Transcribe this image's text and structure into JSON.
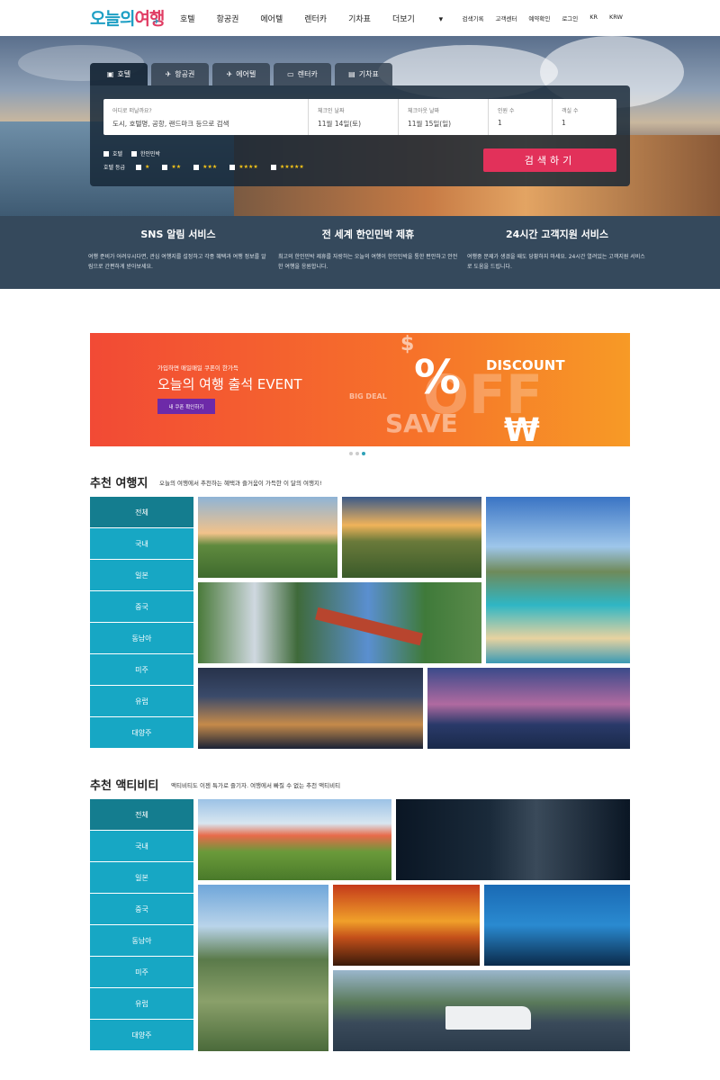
{
  "header": {
    "logo": {
      "part1": "오늘의",
      "part2": "여행"
    },
    "nav": [
      "호텔",
      "항공권",
      "에어텔",
      "렌터카",
      "기차표",
      "더보기"
    ],
    "util": [
      "검색기록",
      "고객센터",
      "예약확인",
      "로그인",
      "KR",
      "KRW"
    ]
  },
  "search": {
    "tabs": [
      "호텔",
      "항공권",
      "에어텔",
      "렌터카",
      "기차표"
    ],
    "fields": [
      {
        "label": "어디로 떠날까요?",
        "value": "도시, 호텔명, 공항, 랜드마크 등으로 검색"
      },
      {
        "label": "체크인 날짜",
        "value": "11월 14일(토)"
      },
      {
        "label": "체크아웃 날짜",
        "value": "11월 15일(일)"
      },
      {
        "label": "인원 수",
        "value": "1"
      },
      {
        "label": "객실 수",
        "value": "1"
      }
    ],
    "checks": [
      "호텔",
      "한인민박"
    ],
    "grade_label": "호텔 등급",
    "stars": [
      "★",
      "★★",
      "★★★",
      "★★★★",
      "★★★★★"
    ],
    "button": "검색하기"
  },
  "services": [
    {
      "title": "SNS 알림 서비스",
      "desc": "여행 준비가 어려우시다면, 관심 여행지를 설정하고 각종 혜택과 여행 정보를 알림으로 간편하게 받아보세요."
    },
    {
      "title": "전 세계 한인민박 제휴",
      "desc": "최고의 한인민박 제휴를 자랑하는 오늘의 여행이 한인민박을 통한 편안하고 안전한 여행을 응원합니다."
    },
    {
      "title": "24시간 고객지원 서비스",
      "desc": "여행중 문제가 생겼을 때도 당황하지 마세요. 24시간 열려있는 고객지원 서비스로 도움을 드립니다."
    }
  ],
  "banner": {
    "subtitle": "가입하면 매일매일 쿠폰이 한가득",
    "title": "오늘의 여행 출석 EVENT",
    "button": "내 쿠폰 확인하기",
    "deco": {
      "discount": "DISCOUNT",
      "bigdeal": "BIG DEAL",
      "save": "SAVE",
      "off": "OFF",
      "percent": "%",
      "dollar": "$",
      "won": "₩"
    }
  },
  "destinations": {
    "title": "추천 여행지",
    "desc": "오늘의 여행에서 추천하는 혜택과 즐거움이 가득한 이 달의 여행지!",
    "categories": [
      "전체",
      "국내",
      "일본",
      "중국",
      "동남아",
      "미주",
      "유럽",
      "대양주"
    ]
  },
  "activities": {
    "title": "추천 액티비티",
    "desc": "액티비티도 이젠 특가로 즐기자. 여행에서 빠질 수 없는 추천 액티비티",
    "categories": [
      "전체",
      "국내",
      "일본",
      "중국",
      "동남아",
      "미주",
      "유럽",
      "대양주"
    ]
  },
  "colors": {
    "accent": "#17a7c4",
    "accent_dark": "#147d8f",
    "search_btn": "#e2315a",
    "service_bg": "#35495c"
  }
}
